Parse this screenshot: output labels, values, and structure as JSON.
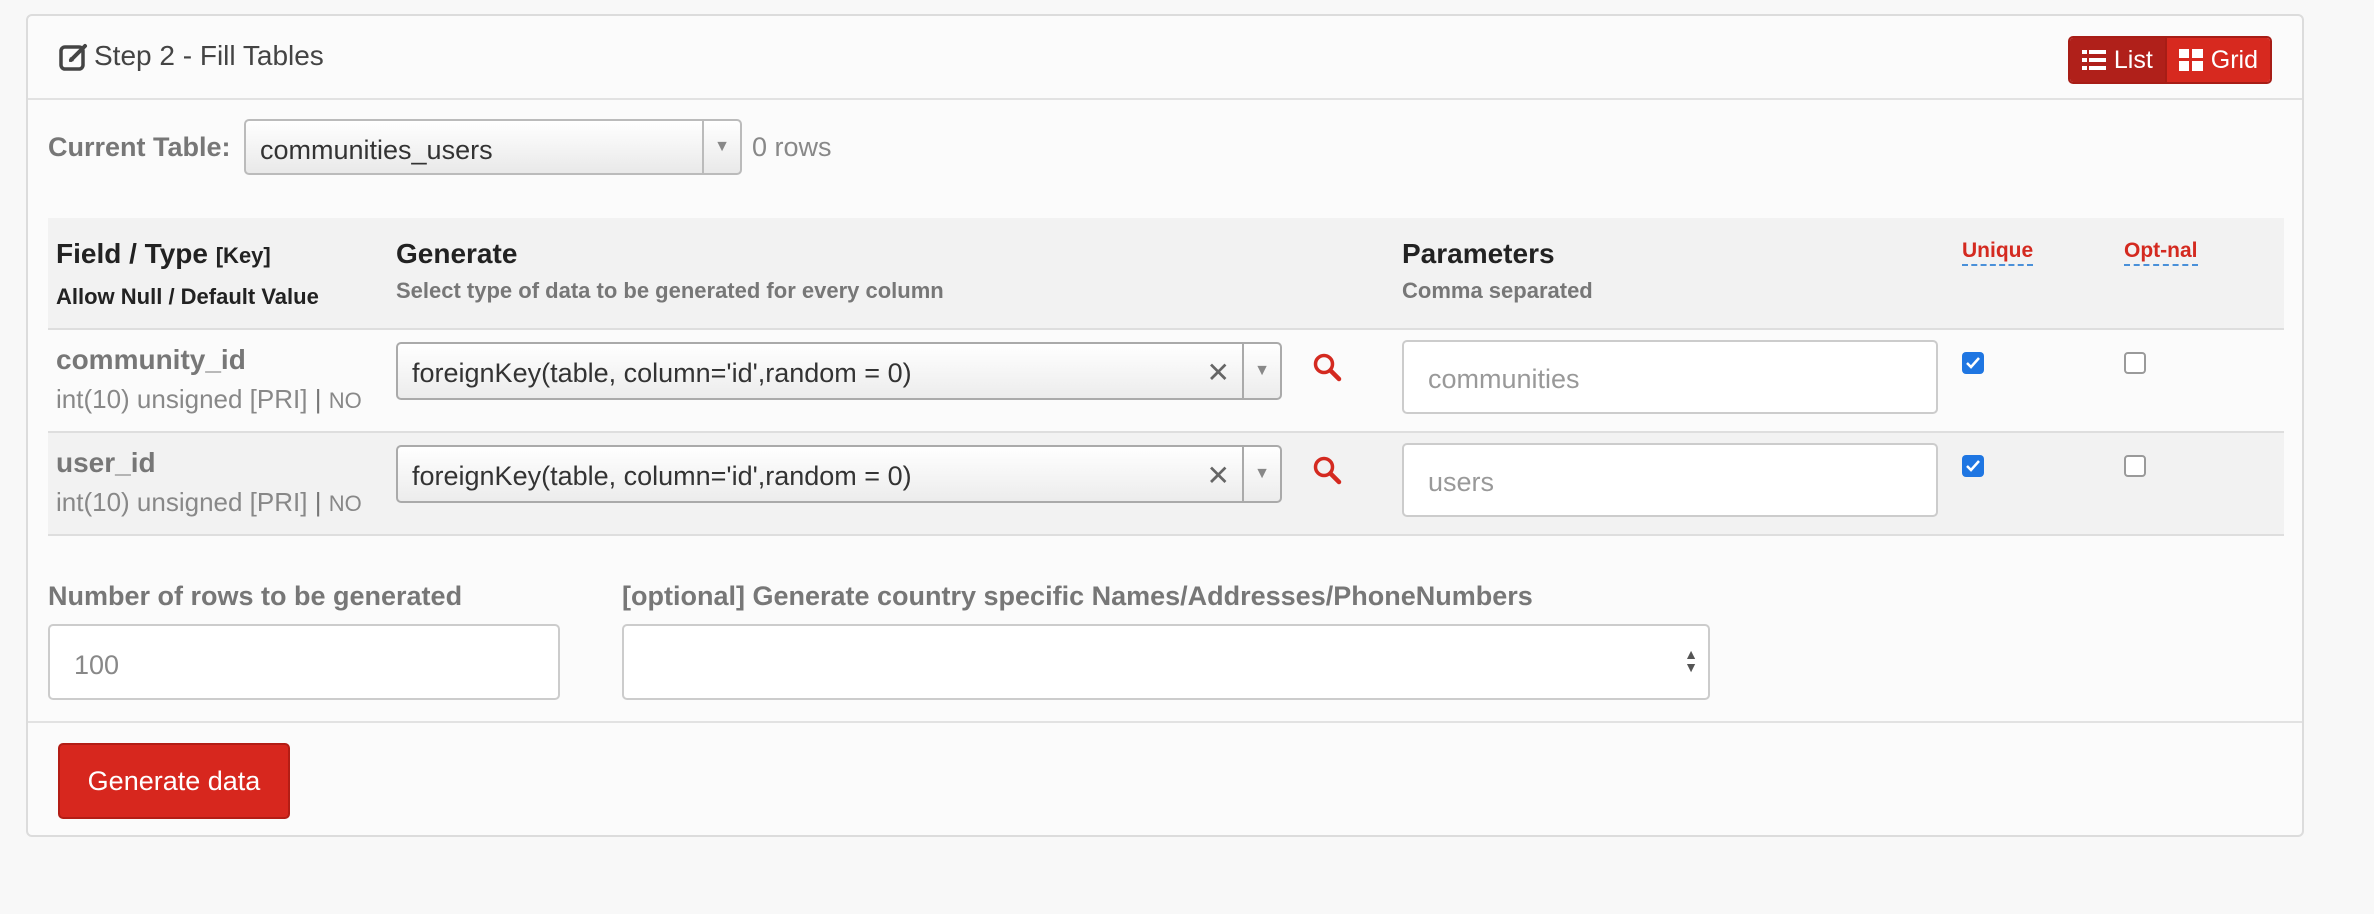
{
  "header": {
    "title": "Step 2 - Fill Tables",
    "view_toggle": {
      "list_label": "List",
      "grid_label": "Grid"
    }
  },
  "current_table": {
    "label": "Current Table:",
    "value": "communities_users",
    "row_count": "0 rows"
  },
  "table": {
    "headers": {
      "field_type": "Field / Type",
      "key": "[Key]",
      "allow_null": "Allow Null / Default Value",
      "generate": "Generate",
      "generate_sub": "Select type of data to be generated for every column",
      "parameters": "Parameters",
      "parameters_sub": "Comma separated",
      "unique": "Unique",
      "optional": "Opt-nal"
    },
    "rows": [
      {
        "name": "community_id",
        "type": "int(10) unsigned [PRI]",
        "sep": "|",
        "null": "NO",
        "generator": "foreignKey(table, column='id',random = 0)",
        "params": "communities",
        "unique": true,
        "optional": false
      },
      {
        "name": "user_id",
        "type": "int(10) unsigned [PRI]",
        "sep": "|",
        "null": "NO",
        "generator": "foreignKey(table, column='id',random = 0)",
        "params": "users",
        "unique": true,
        "optional": false
      }
    ]
  },
  "rows_to_generate": {
    "label": "Number of rows to be generated",
    "placeholder": "100"
  },
  "country": {
    "label": "[optional] Generate country specific Names/Addresses/PhoneNumbers",
    "value": ""
  },
  "actions": {
    "generate_label": "Generate data"
  },
  "colors": {
    "accent": "#d7271e",
    "checkbox": "#1f76e2",
    "link_underline": "#4a90d9"
  },
  "icons": [
    "edit-icon",
    "list-icon",
    "grid-icon",
    "chevron-down-icon",
    "clear-icon",
    "search-icon",
    "checkmark-icon",
    "sort-arrows-icon"
  ]
}
